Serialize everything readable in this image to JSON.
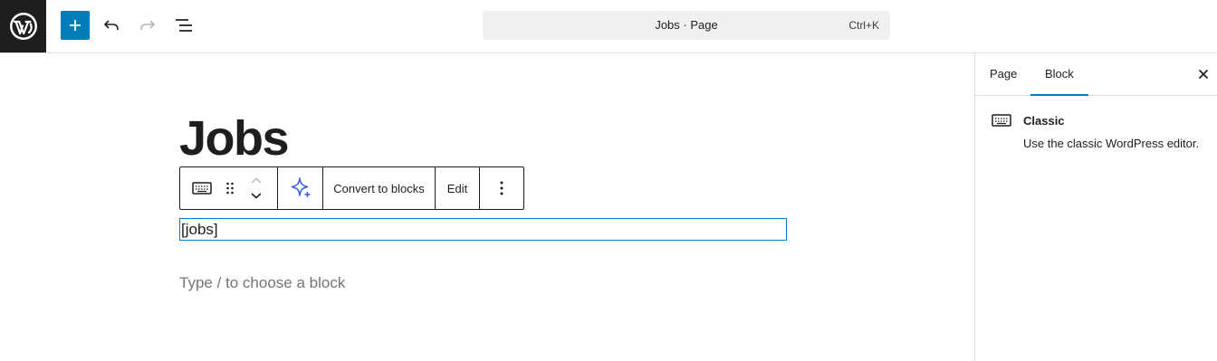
{
  "header": {
    "logo_icon": "wordpress-logo",
    "add_block_icon": "plus-icon",
    "undo_icon": "undo-icon",
    "redo_icon": "redo-icon",
    "document_overview_icon": "list-view-icon",
    "command_bar": {
      "title": "Jobs · Page",
      "shortcut": "Ctrl+K"
    }
  },
  "editor": {
    "title": "Jobs",
    "block_toolbar": {
      "block_icon": "keyboard-icon",
      "drag_icon": "drag-handle-icon",
      "move_up_icon": "chevron-up-icon",
      "move_down_icon": "chevron-down-icon",
      "ai_icon": "sparkle-icon",
      "convert_label": "Convert to blocks",
      "edit_label": "Edit",
      "options_icon": "more-vertical-icon"
    },
    "classic_content": "[jobs]",
    "appender_placeholder": "Type / to choose a block"
  },
  "sidebar": {
    "tabs": [
      {
        "label": "Page",
        "active": false
      },
      {
        "label": "Block",
        "active": true
      }
    ],
    "close_icon": "close-icon",
    "block_card": {
      "icon": "keyboard-icon",
      "title": "Classic",
      "description": "Use the classic WordPress editor."
    }
  },
  "colors": {
    "accent": "#007cba",
    "dark": "#1e1e1e",
    "ai_purple": "#3858e9"
  }
}
